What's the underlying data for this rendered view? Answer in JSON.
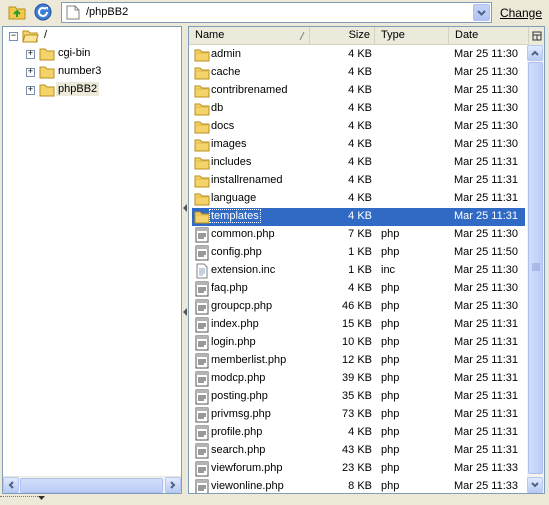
{
  "toolbar": {
    "path": "/phpBB2",
    "change_label": "Change"
  },
  "tree": {
    "root": "/",
    "items": [
      {
        "label": "cgi-bin",
        "expander": "+",
        "selected": false
      },
      {
        "label": "number3",
        "expander": "+",
        "selected": false
      },
      {
        "label": "phpBB2",
        "expander": "+",
        "selected": true
      }
    ]
  },
  "columns": {
    "name": "Name",
    "size": "Size",
    "type": "Type",
    "date": "Date"
  },
  "files": [
    {
      "name": "admin",
      "size": "4 KB",
      "type": "",
      "date": "Mar 25 11:30",
      "icon": "folder",
      "selected": false
    },
    {
      "name": "cache",
      "size": "4 KB",
      "type": "",
      "date": "Mar 25 11:30",
      "icon": "folder",
      "selected": false
    },
    {
      "name": "contribrenamed",
      "size": "4 KB",
      "type": "",
      "date": "Mar 25 11:30",
      "icon": "folder",
      "selected": false
    },
    {
      "name": "db",
      "size": "4 KB",
      "type": "",
      "date": "Mar 25 11:30",
      "icon": "folder",
      "selected": false
    },
    {
      "name": "docs",
      "size": "4 KB",
      "type": "",
      "date": "Mar 25 11:30",
      "icon": "folder",
      "selected": false
    },
    {
      "name": "images",
      "size": "4 KB",
      "type": "",
      "date": "Mar 25 11:30",
      "icon": "folder",
      "selected": false
    },
    {
      "name": "includes",
      "size": "4 KB",
      "type": "",
      "date": "Mar 25 11:31",
      "icon": "folder",
      "selected": false
    },
    {
      "name": "installrenamed",
      "size": "4 KB",
      "type": "",
      "date": "Mar 25 11:31",
      "icon": "folder",
      "selected": false
    },
    {
      "name": "language",
      "size": "4 KB",
      "type": "",
      "date": "Mar 25 11:31",
      "icon": "folder",
      "selected": false
    },
    {
      "name": "templates",
      "size": "4 KB",
      "type": "",
      "date": "Mar 25 11:31",
      "icon": "folder",
      "selected": true
    },
    {
      "name": "common.php",
      "size": "7 KB",
      "type": "php",
      "date": "Mar 25 11:30",
      "icon": "php",
      "selected": false
    },
    {
      "name": "config.php",
      "size": "1 KB",
      "type": "php",
      "date": "Mar 25 11:50",
      "icon": "php",
      "selected": false
    },
    {
      "name": "extension.inc",
      "size": "1 KB",
      "type": "inc",
      "date": "Mar 25 11:30",
      "icon": "doc",
      "selected": false
    },
    {
      "name": "faq.php",
      "size": "4 KB",
      "type": "php",
      "date": "Mar 25 11:30",
      "icon": "php",
      "selected": false
    },
    {
      "name": "groupcp.php",
      "size": "46 KB",
      "type": "php",
      "date": "Mar 25 11:30",
      "icon": "php",
      "selected": false
    },
    {
      "name": "index.php",
      "size": "15 KB",
      "type": "php",
      "date": "Mar 25 11:31",
      "icon": "php",
      "selected": false
    },
    {
      "name": "login.php",
      "size": "10 KB",
      "type": "php",
      "date": "Mar 25 11:31",
      "icon": "php",
      "selected": false
    },
    {
      "name": "memberlist.php",
      "size": "12 KB",
      "type": "php",
      "date": "Mar 25 11:31",
      "icon": "php",
      "selected": false
    },
    {
      "name": "modcp.php",
      "size": "39 KB",
      "type": "php",
      "date": "Mar 25 11:31",
      "icon": "php",
      "selected": false
    },
    {
      "name": "posting.php",
      "size": "35 KB",
      "type": "php",
      "date": "Mar 25 11:31",
      "icon": "php",
      "selected": false
    },
    {
      "name": "privmsg.php",
      "size": "73 KB",
      "type": "php",
      "date": "Mar 25 11:31",
      "icon": "php",
      "selected": false
    },
    {
      "name": "profile.php",
      "size": "4 KB",
      "type": "php",
      "date": "Mar 25 11:31",
      "icon": "php",
      "selected": false
    },
    {
      "name": "search.php",
      "size": "43 KB",
      "type": "php",
      "date": "Mar 25 11:31",
      "icon": "php",
      "selected": false
    },
    {
      "name": "viewforum.php",
      "size": "23 KB",
      "type": "php",
      "date": "Mar 25 11:33",
      "icon": "php",
      "selected": false
    },
    {
      "name": "viewonline.php",
      "size": "8 KB",
      "type": "php",
      "date": "Mar 25 11:33",
      "icon": "php",
      "selected": false
    }
  ],
  "colors": {
    "selection": "#316ac5",
    "folder": "#f5d36b",
    "border": "#7f9db9"
  }
}
